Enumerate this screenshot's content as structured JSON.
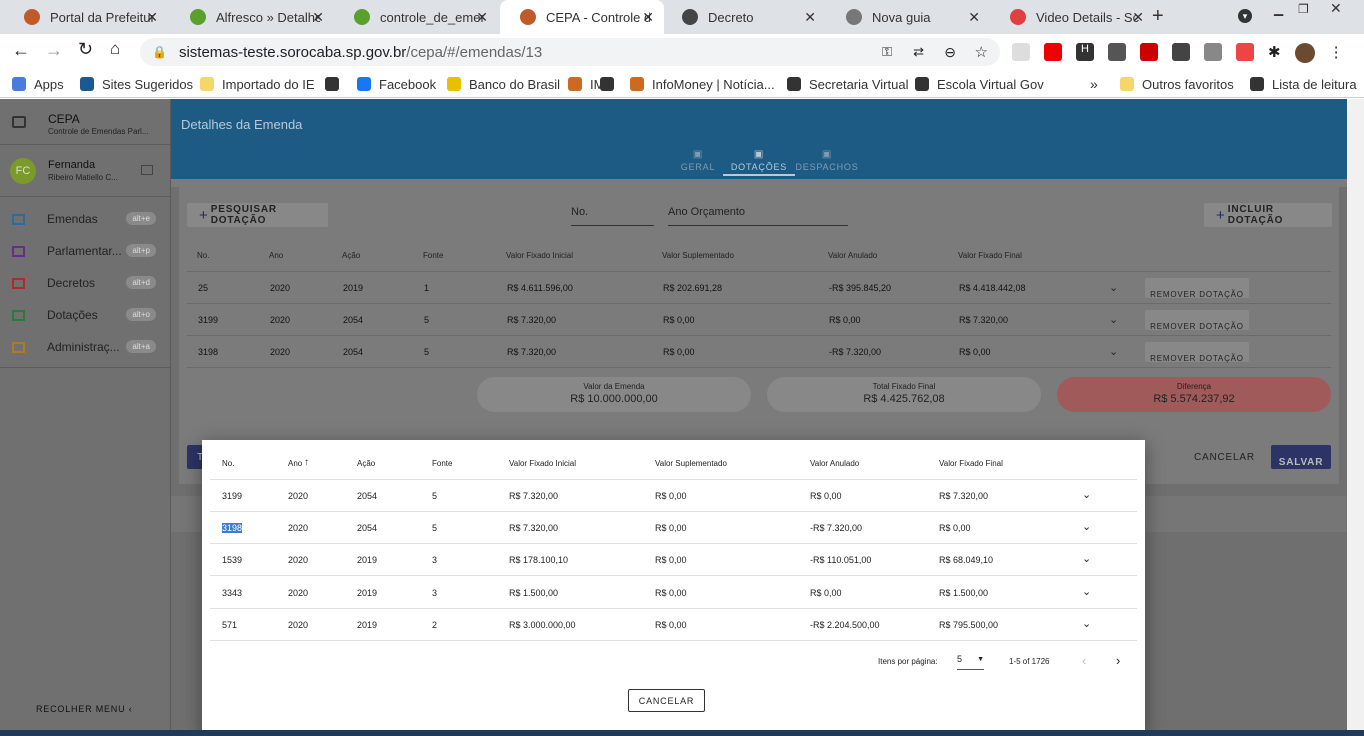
{
  "browser": {
    "tabs": [
      {
        "title": "Portal da Prefeitura",
        "fav": "#c05a2a"
      },
      {
        "title": "Alfresco » Detalhes",
        "fav": "#5aa02c"
      },
      {
        "title": "controle_de_emenda",
        "fav": "#5aa02c"
      },
      {
        "title": "CEPA - Controle de",
        "fav": "#c05a2a"
      },
      {
        "title": "Decreto",
        "fav": "#444"
      },
      {
        "title": "Nova guia",
        "fav": "#777"
      },
      {
        "title": "Video Details - Scre",
        "fav": "#e04040"
      }
    ],
    "url_host": "sistemas-teste.sorocaba.sp.gov.br",
    "url_path": "/cepa/#/emendas/13",
    "bookmarks": [
      "Apps",
      "Sites Sugeridos",
      "Importado do IE",
      "Facebook",
      "Banco do Brasil",
      "IM",
      "InfoMoney | Notícia...",
      "Secretaria Virtual",
      "Escola Virtual Gov",
      "Outros favoritos",
      "Lista de leitura"
    ]
  },
  "app": {
    "title": "CEPA",
    "subtitle": "Controle de Emendas Parl...",
    "user_initials": "FC",
    "user_name": "Fernanda",
    "user_sub": "Ribeiro Matiello C...",
    "nav": [
      {
        "label": "Emendas",
        "key": "alt+e",
        "color": "#2c6aa0"
      },
      {
        "label": "Parlamentar...",
        "key": "alt+p",
        "color": "#6a2c8a"
      },
      {
        "label": "Decretos",
        "key": "alt+d",
        "color": "#b02a2a"
      },
      {
        "label": "Dotações",
        "key": "alt+o",
        "color": "#2a7a3a"
      },
      {
        "label": "Administraç...",
        "key": "alt+a",
        "color": "#b07a20"
      }
    ],
    "collapse_label": "RECOLHER MENU"
  },
  "page": {
    "title": "Detalhes da Emenda",
    "tabs": [
      "GERAL",
      "DOTAÇÕES",
      "DESPACHOS"
    ],
    "search_button": "PESQUISAR DOTAÇÃO",
    "field_no": "No.",
    "field_ano": "Ano Orçamento",
    "include_button": "INCLUIR DOTAÇÃO",
    "columns": [
      "No.",
      "Ano",
      "Ação",
      "Fonte",
      "Valor Fixado Inicial",
      "Valor Suplementado",
      "Valor Anulado",
      "Valor Fixado Final"
    ],
    "rows": [
      [
        "25",
        "2020",
        "2019",
        "1",
        "R$ 4.611.596,00",
        "R$ 202.691,28",
        "-R$ 395.845,20",
        "R$ 4.418.442,08"
      ],
      [
        "3199",
        "2020",
        "2054",
        "5",
        "R$ 7.320,00",
        "R$ 0,00",
        "R$ 0,00",
        "R$ 7.320,00"
      ],
      [
        "3198",
        "2020",
        "2054",
        "5",
        "R$ 7.320,00",
        "R$ 0,00",
        "-R$ 7.320,00",
        "R$ 0,00"
      ]
    ],
    "remove_label": "REMOVER DOTAÇÃO",
    "summary": [
      {
        "label": "Valor da Emenda",
        "value": "R$ 10.000.000,00"
      },
      {
        "label": "Total Fixado Final",
        "value": "R$ 4.425.762,08"
      },
      {
        "label": "Diferença",
        "value": "R$ 5.574.237,92"
      }
    ],
    "cancel": "CANCELAR",
    "save": "SALVAR",
    "back_stub": "T"
  },
  "modal": {
    "columns": [
      "No.",
      "Ano",
      "Ação",
      "Fonte",
      "Valor Fixado Inicial",
      "Valor Suplementado",
      "Valor Anulado",
      "Valor Fixado Final"
    ],
    "sort_icon": "↑",
    "rows": [
      [
        "3199",
        "2020",
        "2054",
        "5",
        "R$ 7.320,00",
        "R$ 0,00",
        "R$ 0,00",
        "R$ 7.320,00"
      ],
      [
        "3198",
        "2020",
        "2054",
        "5",
        "R$ 7.320,00",
        "R$ 0,00",
        "-R$ 7.320,00",
        "R$ 0,00"
      ],
      [
        "1539",
        "2020",
        "2019",
        "3",
        "R$ 178.100,10",
        "R$ 0,00",
        "-R$ 110.051,00",
        "R$ 68.049,10"
      ],
      [
        "3343",
        "2020",
        "2019",
        "3",
        "R$ 1.500,00",
        "R$ 0,00",
        "R$ 0,00",
        "R$ 1.500,00"
      ],
      [
        "571",
        "2020",
        "2019",
        "2",
        "R$ 3.000.000,00",
        "R$ 0,00",
        "-R$ 2.204.500,00",
        "R$ 795.500,00"
      ]
    ],
    "items_label": "Itens por página:",
    "items_value": "5",
    "range": "1-5 of 1726",
    "cancel": "CANCELAR"
  }
}
